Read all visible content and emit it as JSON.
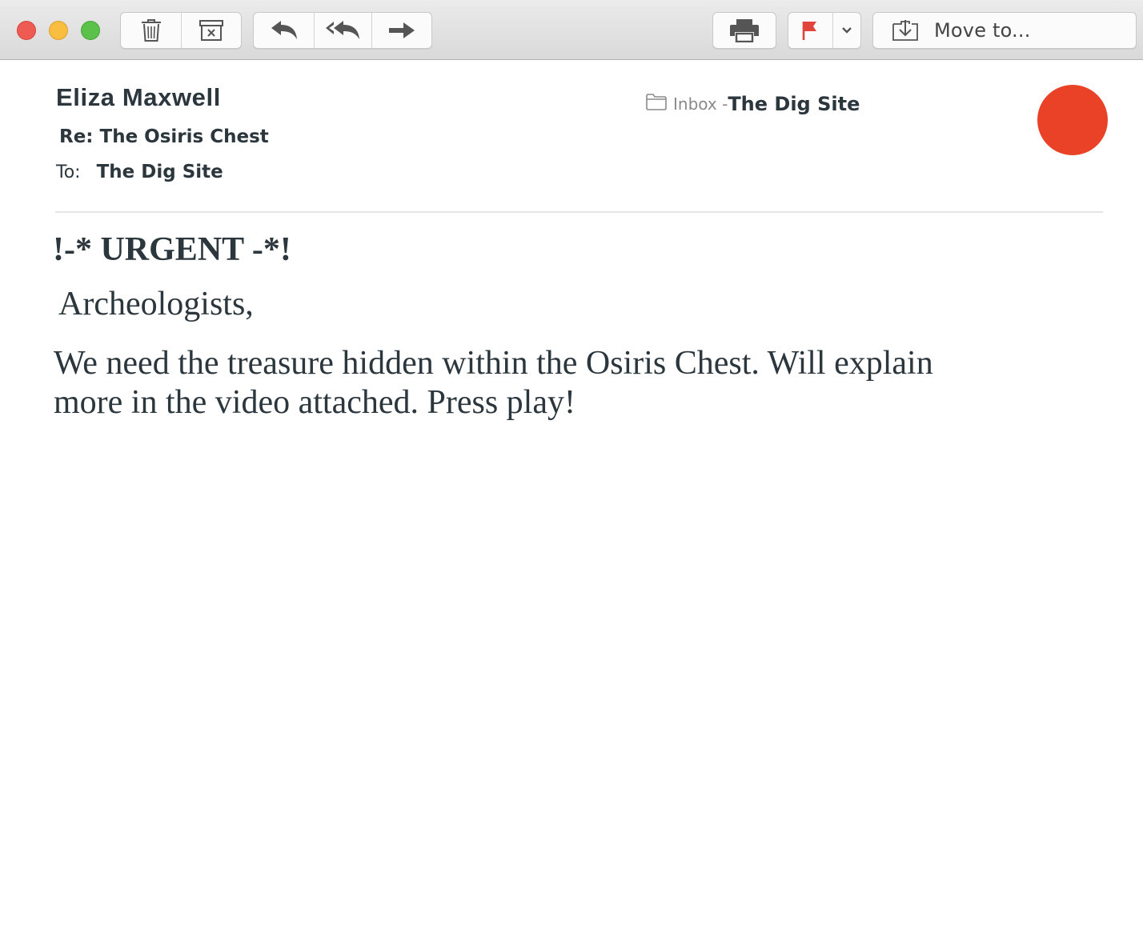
{
  "toolbar": {
    "window_controls": [
      "close",
      "minimize",
      "maximize"
    ],
    "buttons": [
      {
        "name": "trash-icon"
      },
      {
        "name": "archive-icon"
      },
      {
        "name": "reply-icon"
      },
      {
        "name": "reply-all-icon"
      },
      {
        "name": "forward-icon"
      },
      {
        "name": "print-icon"
      },
      {
        "name": "flag-icon",
        "color": "#e0443a"
      },
      {
        "name": "chevron-down-icon"
      }
    ],
    "move_label": "Move to..."
  },
  "message": {
    "sender": "Eliza Maxwell",
    "subject": "Re: The Osiris Chest",
    "to_label": "To:",
    "to_value": "The Dig Site",
    "mailbox_label": "Inbox -",
    "mailbox_name": "The Dig Site",
    "avatar_color": "#e94227",
    "headline": "!-* URGENT -*!",
    "greeting": "Archeologists,",
    "body": "We need the treasure hidden within the Osiris Chest. Will explain more in the video attached. Press play!"
  }
}
